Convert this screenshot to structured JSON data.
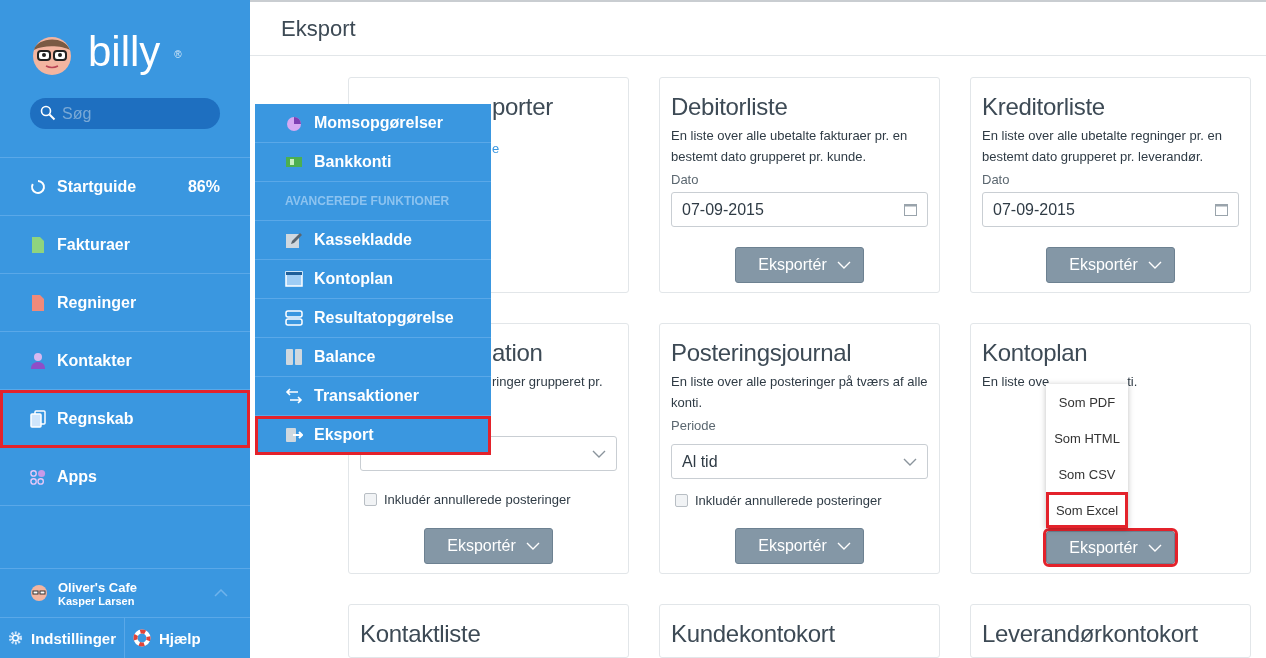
{
  "sidebar": {
    "logo": {
      "text": "billy",
      "mark": "®"
    },
    "search": {
      "placeholder": "Søg"
    },
    "items": [
      {
        "label": "Startguide",
        "badge": "86%",
        "highlighted": false
      },
      {
        "label": "Fakturaer",
        "highlighted": false
      },
      {
        "label": "Regninger",
        "highlighted": false
      },
      {
        "label": "Kontakter",
        "highlighted": false
      },
      {
        "label": "Regnskab",
        "highlighted": true
      },
      {
        "label": "Apps",
        "highlighted": false
      }
    ],
    "user": {
      "company": "Oliver's Cafe",
      "name": "Kasper Larsen"
    },
    "footer": [
      "Indstillinger",
      "Hjælp"
    ]
  },
  "flyout": {
    "items": [
      {
        "kind": "link",
        "label": "Momsopgørelser",
        "highlighted": false
      },
      {
        "kind": "link",
        "label": "Bankkonti",
        "highlighted": false
      },
      {
        "kind": "heading",
        "label": "AVANCEREDE FUNKTIONER"
      },
      {
        "kind": "link",
        "label": "Kassekladde",
        "highlighted": false
      },
      {
        "kind": "link",
        "label": "Kontoplan",
        "highlighted": false
      },
      {
        "kind": "link",
        "label": "Resultatopgørelse",
        "highlighted": false
      },
      {
        "kind": "link",
        "label": "Balance",
        "highlighted": false
      },
      {
        "kind": "link",
        "label": "Transaktioner",
        "highlighted": false
      },
      {
        "kind": "link",
        "label": "Eksport",
        "highlighted": true
      }
    ]
  },
  "page": {
    "title": "Eksport"
  },
  "cards": [
    {
      "kind": "covered",
      "title": "porter",
      "link": "e"
    },
    {
      "kind": "full",
      "title": "Debitorliste",
      "description": "En liste over alle ubetalte fakturaer pr. en bestemt dato grupperet pr. kunde.",
      "field": {
        "kind": "date",
        "label": "Dato",
        "value": "07-09-2015"
      },
      "button": {
        "label": "Eksportér",
        "highlighted": false
      }
    },
    {
      "kind": "full",
      "title": "Kreditorliste",
      "description": "En liste over alle ubetalte regninger pr. en bestemt dato grupperet pr. leverandør.",
      "field": {
        "kind": "date",
        "label": "Dato",
        "value": "07-09-2015"
      },
      "button": {
        "label": "Eksportér",
        "highlighted": false
      }
    },
    {
      "kind": "covered",
      "title": "ation",
      "description": "ringer grupperet pr.",
      "field": {
        "kind": "select"
      },
      "checkbox": {
        "label": "Inkludér annullerede posteringer",
        "checked": false
      },
      "button": {
        "label": "Eksportér",
        "highlighted": false
      }
    },
    {
      "kind": "full",
      "title": "Posteringsjournal",
      "description": "En liste over alle posteringer på tværs af alle konti.",
      "field": {
        "kind": "select",
        "label": "Periode",
        "value": "Al tid"
      },
      "checkbox": {
        "label": "Inkludér annullerede posteringer",
        "checked": false
      },
      "button": {
        "label": "Eksportér",
        "highlighted": false
      }
    },
    {
      "kind": "full",
      "title": "Kontoplan",
      "description_parts": [
        "En liste ove",
        "ti."
      ],
      "menu": [
        {
          "label": "Som PDF",
          "highlighted": false
        },
        {
          "label": "Som HTML",
          "highlighted": false
        },
        {
          "label": "Som CSV",
          "highlighted": false
        },
        {
          "label": "Som Excel",
          "highlighted": true
        }
      ],
      "button": {
        "label": "Eksportér",
        "highlighted": true
      }
    },
    {
      "kind": "full",
      "title": "Kontaktliste"
    },
    {
      "kind": "full",
      "title": "Kundekontokort"
    },
    {
      "kind": "full",
      "title": "Leverandørkontokort"
    }
  ]
}
